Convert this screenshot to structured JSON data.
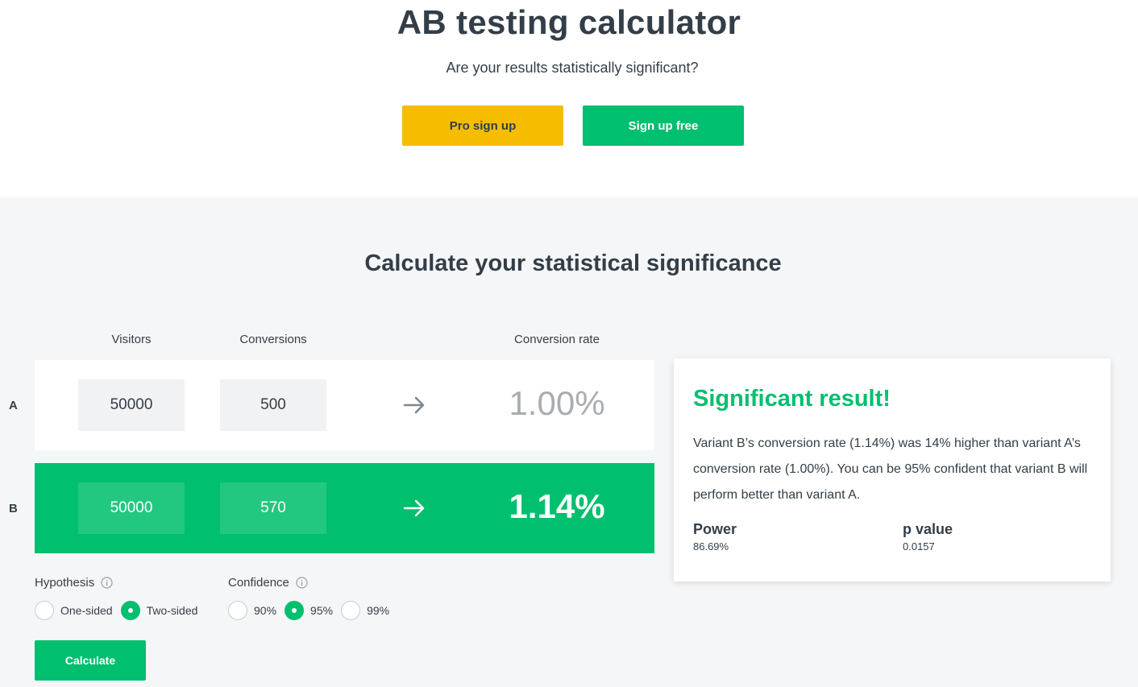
{
  "header": {
    "title": "AB testing calculator",
    "subtitle": "Are your results statistically significant?",
    "pro_button": "Pro sign up",
    "free_button": "Sign up free"
  },
  "calculator": {
    "title": "Calculate your statistical significance",
    "columns": {
      "visitors": "Visitors",
      "conversions": "Conversions",
      "rate": "Conversion rate"
    },
    "variants": [
      {
        "label": "A",
        "visitors": "50000",
        "conversions": "500",
        "rate": "1.00%"
      },
      {
        "label": "B",
        "visitors": "50000",
        "conversions": "570",
        "rate": "1.14%"
      }
    ],
    "hypothesis": {
      "label": "Hypothesis",
      "options": [
        "One-sided",
        "Two-sided"
      ],
      "selected": "Two-sided"
    },
    "confidence": {
      "label": "Confidence",
      "options": [
        "90%",
        "95%",
        "99%"
      ],
      "selected": "95%"
    },
    "calculate_button": "Calculate"
  },
  "result": {
    "title": "Significant result!",
    "text": "Variant B’s conversion rate (1.14%) was 14% higher than variant A’s conversion rate (1.00%). You can be 95% confident that variant B will perform better than variant A.",
    "power_label": "Power",
    "power_value": "86.69%",
    "p_label": "p value",
    "p_value": "0.0157"
  },
  "colors": {
    "brand_green": "#00bf6f",
    "pro_yellow": "#f6bd00",
    "text_dark": "#333e48",
    "background_gray": "#f5f6f7"
  },
  "icons": {
    "arrow": "arrow-right-icon",
    "info": "info-icon"
  }
}
